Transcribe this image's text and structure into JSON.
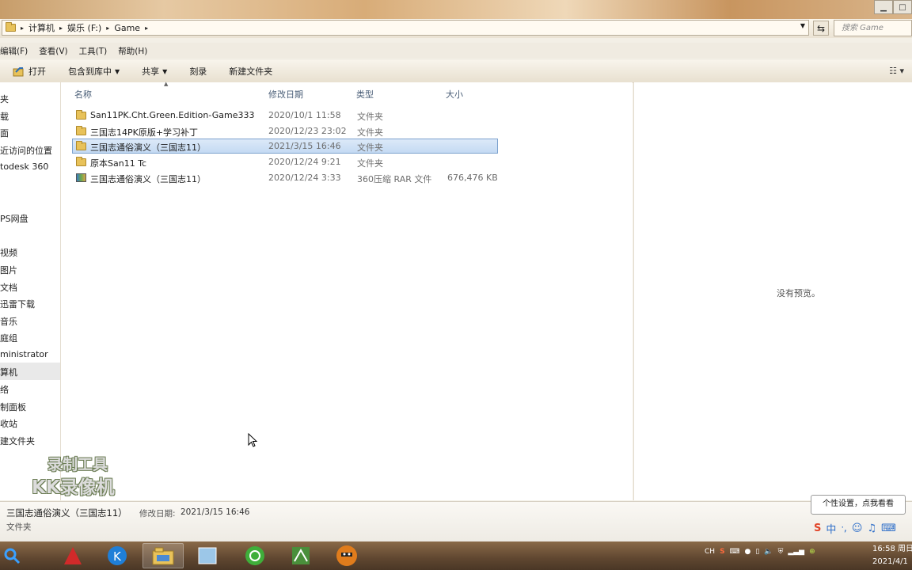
{
  "address": {
    "crumbs": [
      "计算机",
      "娱乐 (F:)",
      "Game"
    ],
    "search_placeholder": "搜索 Game"
  },
  "menu": [
    "编辑(F)",
    "查看(V)",
    "工具(T)",
    "帮助(H)"
  ],
  "toolbar": {
    "open": "打开",
    "include_library": "包含到库中",
    "share": "共享",
    "burn": "刻录",
    "new_folder": "新建文件夹"
  },
  "nav": {
    "items": [
      "夹",
      "载",
      "面",
      "近访问的位置",
      "todesk 360",
      "PS网盘",
      "视频",
      "图片",
      "文档",
      "迅雷下载",
      "音乐",
      "庭组",
      "ministrator",
      "算机",
      "络",
      "制面板",
      "收站",
      "建文件夹"
    ]
  },
  "columns": {
    "name": "名称",
    "date": "修改日期",
    "type": "类型",
    "size": "大小"
  },
  "files": [
    {
      "name": "San11PK.Cht.Green.Edition-Game333",
      "date": "2020/10/1 11:58",
      "type": "文件夹",
      "size": "",
      "kind": "folder"
    },
    {
      "name": "三国志14PK原版+学习补丁",
      "date": "2020/12/23 23:02",
      "type": "文件夹",
      "size": "",
      "kind": "folder"
    },
    {
      "name": "三国志通俗演义（三国志11）",
      "date": "2021/3/15 16:46",
      "type": "文件夹",
      "size": "",
      "kind": "folder",
      "selected": true
    },
    {
      "name": "原本San11 Tc",
      "date": "2020/12/24 9:21",
      "type": "文件夹",
      "size": "",
      "kind": "folder"
    },
    {
      "name": "三国志通俗演义（三国志11）",
      "date": "2020/12/24 3:33",
      "type": "360压缩 RAR 文件",
      "size": "676,476 KB",
      "kind": "rar"
    }
  ],
  "preview": {
    "text": "没有预览。"
  },
  "details": {
    "name": "三国志通俗演义（三国志11）",
    "modified_label": "修改日期:",
    "modified_value": "2021/3/15 16:46",
    "type": "文件夹"
  },
  "watermark": {
    "line1": "录制工具",
    "line2": "KK录像机"
  },
  "tooltip": "个性设置，点我看看",
  "ime": {
    "lang": "中"
  },
  "tray": {
    "lang": "CH"
  },
  "clock": {
    "time": "16:58 周日",
    "date": "2021/4/1"
  },
  "colors": {
    "selection": "#c4daf3",
    "selection_border": "#7da2ce",
    "folder": "#e8c25a",
    "header_text": "#4b5f78"
  }
}
